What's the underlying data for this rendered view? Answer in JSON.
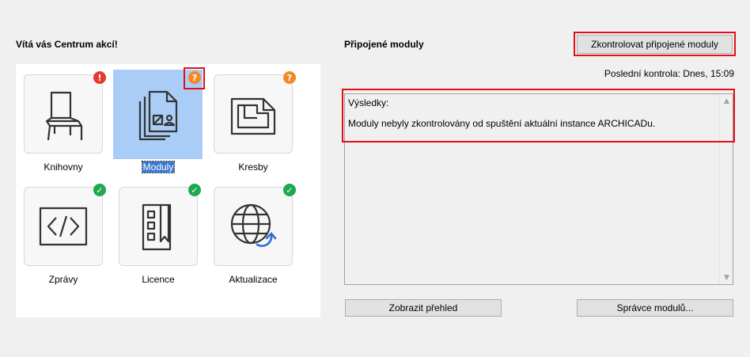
{
  "welcome": {
    "title": "Vítá vás Centrum akcí!"
  },
  "tiles": [
    {
      "label": "Knihovny",
      "status": "!",
      "icon": "chair-icon"
    },
    {
      "label": "Moduly",
      "status": "?",
      "icon": "modules-document-icon"
    },
    {
      "label": "Kresby",
      "status": "?",
      "icon": "drawings-icon"
    },
    {
      "label": "Zprávy",
      "status": "✓",
      "icon": "code-report-icon"
    },
    {
      "label": "Licence",
      "status": "✓",
      "icon": "license-icon"
    },
    {
      "label": "Aktualizace",
      "status": "✓",
      "icon": "globe-update-icon"
    }
  ],
  "modules": {
    "title": "Připojené moduly",
    "check_button": "Zkontrolovat připojené moduly",
    "last_check": "Poslední kontrola: Dnes, 15:09",
    "results_label": "Výsledky:",
    "results_message": "Moduly nebyly zkontrolovány od spuštění aktuální instance ARCHICADu.",
    "show_overview_button": "Zobrazit přehled",
    "module_manager_button": "Správce modulů..."
  },
  "colors": {
    "error": "#e53b2c",
    "warning": "#f08a24",
    "ok": "#1fa84f",
    "selection": "#a9cdf7",
    "highlight_frame": "#e0101a"
  }
}
